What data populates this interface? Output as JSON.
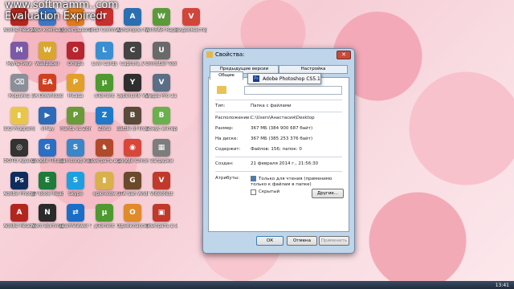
{
  "watermark": {
    "line1": "www.softmamm..com",
    "line2": "Evaluation Expired"
  },
  "desktop_icons": [
    {
      "label": "Adobe Reader 9",
      "color": "#b3261e",
      "glyph": "A",
      "icon": "reader-icon"
    },
    {
      "label": "Мой компьютер",
      "color": "#3b78c4",
      "glyph": "▣",
      "icon": "computer-icon"
    },
    {
      "label": "Проигрыватель",
      "color": "#e07a1f",
      "glyph": "▶",
      "icon": "player-icon"
    },
    {
      "label": "Total Commander",
      "color": "#c82f2f",
      "glyph": "T",
      "icon": "total-commander-icon"
    },
    {
      "label": "Ashampoo Magical",
      "color": "#2a6fb0",
      "glyph": "A",
      "icon": "ashampoo-icon"
    },
    {
      "label": "WinRAR Rapid",
      "color": "#5a9a3a",
      "glyph": "W",
      "icon": "winrar-icon"
    },
    {
      "label": "Видеомастер",
      "color": "#d0463a",
      "glyph": "V",
      "icon": "video-icon"
    },
    {
      "label": "Мультики",
      "color": "#7a5aa6",
      "glyph": "M",
      "icon": "folder-icon"
    },
    {
      "label": "Wallpaper",
      "color": "#d9a62e",
      "glyph": "W",
      "icon": "wallpaper-icon"
    },
    {
      "label": "Опера",
      "color": "#b7252f",
      "glyph": "O",
      "icon": "opera-icon"
    },
    {
      "label": "Live Cards",
      "color": "#3a8fd0",
      "glyph": "L",
      "icon": "cards-icon"
    },
    {
      "label": "Capture_V",
      "color": "#444",
      "glyph": "C",
      "icon": "capture-icon"
    },
    {
      "label": "Uninstall Tool",
      "color": "#6a6a6a",
      "glyph": "U",
      "icon": "uninstall-icon"
    },
    {
      "label": "Корзина",
      "color": "#8a8f99",
      "glyph": "⌫",
      "icon": "recycle-bin-icon"
    },
    {
      "label": "EA Download Manager",
      "color": "#d04020",
      "glyph": "EA",
      "icon": "ea-icon"
    },
    {
      "label": "Picasa",
      "color": "#e0a02a",
      "glyph": "P",
      "icon": "picasa-icon"
    },
    {
      "label": "uTorrent",
      "color": "#4e9a2f",
      "glyph": "µ",
      "icon": "utorrent-icon"
    },
    {
      "label": "CyberLink YouCam",
      "color": "#2f2f2f",
      "glyph": "Y",
      "icon": "youcam-icon"
    },
    {
      "label": "Vegas Pro 11.0 (64-bit)",
      "color": "#5a6e85",
      "glyph": "V",
      "icon": "vegas-icon"
    },
    {
      "label": "ICQ Programs",
      "color": "#e9c64a",
      "glyph": "▮",
      "icon": "folder-icon"
    },
    {
      "label": "vPlay",
      "color": "#2d6bb8",
      "glyph": "▶",
      "icon": "vplay-icon"
    },
    {
      "label": "Plants vs Zombies",
      "color": "#6a9a3a",
      "glyph": "P",
      "icon": "game-icon"
    },
    {
      "label": "Zona",
      "color": "#1e7ac8",
      "glyph": "Z",
      "icon": "zona-icon"
    },
    {
      "label": "Battle of Frontier",
      "color": "#5a4a3a",
      "glyph": "B",
      "icon": "game-icon"
    },
    {
      "label": "Бонус интернет",
      "color": "#6ab04c",
      "glyph": "B",
      "icon": "bonus-icon"
    },
    {
      "label": "ФОТО Aparat",
      "color": "#333",
      "glyph": "◎",
      "icon": "camera-icon"
    },
    {
      "label": "Google Планета",
      "color": "#2a6fc4",
      "glyph": "G",
      "icon": "google-earth-icon"
    },
    {
      "label": "Samsung Kies",
      "color": "#3a86c8",
      "glyph": "S",
      "icon": "samsung-icon"
    },
    {
      "label": "Поиграть в шахматы",
      "color": "#b04a2a",
      "glyph": "♞",
      "icon": "chess-icon"
    },
    {
      "label": "Google Chrome",
      "color": "#d9463a",
      "glyph": "◉",
      "icon": "chrome-icon"
    },
    {
      "label": "Загрузки",
      "color": "#7d7d7d",
      "glyph": "▦",
      "icon": "downloads-icon"
    },
    {
      "label": "Adobe Photoshop",
      "color": "#0e2c5c",
      "glyph": "Ps",
      "icon": "photoshop-icon"
    },
    {
      "label": "E7 Book Reader",
      "color": "#1e7b3a",
      "glyph": "E",
      "icon": "book-icon"
    },
    {
      "label": "Skype",
      "color": "#1ea0e0",
      "glyph": "S",
      "icon": "skype-icon"
    },
    {
      "label": "крючком",
      "color": "#d9b04a",
      "glyph": "▮",
      "icon": "folder-icon"
    },
    {
      "label": "GTA San Andreas",
      "color": "#6a4a2a",
      "glyph": "G",
      "icon": "gta-icon"
    },
    {
      "label": "Videofest",
      "color": "#c0392b",
      "glyph": "V",
      "icon": "videofest-icon"
    },
    {
      "label": "Adobe Reader X",
      "color": "#b3261e",
      "glyph": "A",
      "icon": "reader-icon"
    },
    {
      "label": "Nero Burning ROM",
      "color": "#2b2b2b",
      "glyph": "N",
      "icon": "nero-icon"
    },
    {
      "label": "TeamViewer 7",
      "color": "#1a6ec8",
      "glyph": "⇄",
      "icon": "teamviewer-icon"
    },
    {
      "label": "µTorrent",
      "color": "#4e9a2f",
      "glyph": "µ",
      "icon": "utorrent-icon"
    },
    {
      "label": "Одноклассники",
      "color": "#e08a2a",
      "glyph": "О",
      "icon": "ok-icon"
    },
    {
      "label": "Поиграть в игры",
      "color": "#c0392b",
      "glyph": "▣",
      "icon": "games-icon"
    }
  ],
  "dialog": {
    "title": "Свойства:",
    "close_glyph": "✕",
    "tabs": {
      "prev_versions": "Предыдущие версии",
      "settings": "Настройка",
      "general": "Общие"
    },
    "popup_text": "Adobe Photoshop CS5.1",
    "popup_badge": "Ps",
    "rows": {
      "type_label": "Тип:",
      "type_value": "Папка с файлами",
      "location_label": "Расположение:",
      "location_value": "C:\\Users\\Анастасия\\Desktop",
      "size_label": "Размер:",
      "size_value": "367 МБ (384 900 687 байт)",
      "disk_label": "На диске:",
      "disk_value": "367 МБ (385 253 376 байт)",
      "contains_label": "Содержит:",
      "contains_value": "Файлов: 156; папок: 0",
      "created_label": "Создан:",
      "created_value": "21 февраля 2014 г., 21:56:30",
      "attributes_label": "Атрибуты:",
      "readonly_text": "Только для чтения (применимо только к файлам в папке)",
      "hidden_text": "Скрытый",
      "other_button": "Другие..."
    },
    "buttons": {
      "ok": "ОК",
      "cancel": "Отмена",
      "apply": "Применить"
    }
  },
  "taskbar": {
    "clock": "13:41"
  }
}
